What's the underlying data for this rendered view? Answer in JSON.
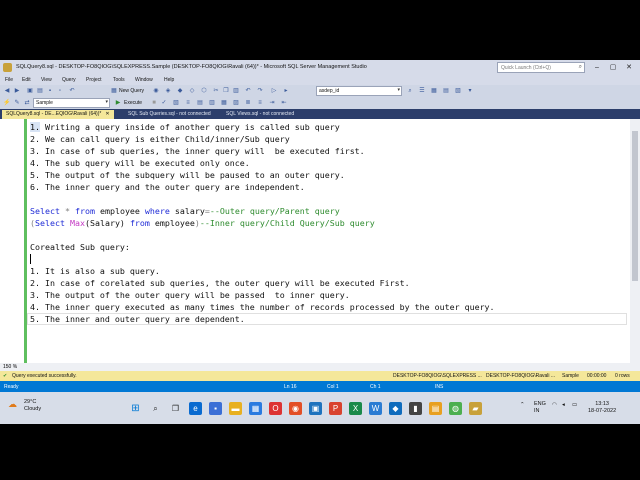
{
  "window": {
    "title": "SQLQuery8.sql - DESKTOP-FO8QIOG\\SQLEXPRESS.Sample (DESKTOP-FO8QIOG\\Ravali (64))* - Microsoft SQL Server Management Studio",
    "quick_launch_placeholder": "Quick Launch (Ctrl+Q)"
  },
  "menu": [
    "File",
    "Edit",
    "View",
    "Query",
    "Project",
    "Tools",
    "Window",
    "Help"
  ],
  "toolbar": {
    "new_query": "New Query",
    "execute": "Execute",
    "database": "Sample",
    "combo_right": "asdep_id"
  },
  "tabs": [
    {
      "label": "SQLQuery8.sql - DE...EQIOG\\Ravali (64))*",
      "active": true
    },
    {
      "label": "SQL Sub Queries.sql - not connected",
      "active": false
    },
    {
      "label": "SQL Views.sql - not connected",
      "active": false
    }
  ],
  "editor": {
    "lines": {
      "l1": {
        "num": "1.",
        "text": " Writing a query inside of another query is called sub query"
      },
      "l2": {
        "num": "2.",
        "text": " We can call query is either Child/inner/Sub query"
      },
      "l3a": "3. In case of sub queries, the inner query will  be executed first.",
      "l4": "4. The sub query will be executed only once.",
      "l5a": "5. The output of the subquery will be paused to an outer query.",
      "l6": "6. The inner query and the outer query are independent.",
      "select_line": {
        "select": "Select",
        "star": " * ",
        "from": "from",
        "employee": " employee ",
        "where": "where",
        "salary": " salary",
        "eq": "=",
        "comment": "--Outer query/Parent query"
      },
      "sub_line": {
        "open": "(",
        "select": "Select",
        "max": " Max",
        "salary": "(Salary) ",
        "from": "from",
        "employee": " employee",
        "close": ")",
        "comment": "--Inner query/Child Query/Sub query"
      },
      "corealted": "Corealted Sub query:",
      "c1": "1. It is also a sub query.",
      "c2": "2. In case of corelated sub queries, the outer query will be executed First.",
      "c3": "3. The output of the outer query will be passed  to inner query.",
      "c4": "4. The inner query executed as many times the number of records processed by the outer query.",
      "c5": "5. The inner and outer query are dependent."
    },
    "zoom": "150 %"
  },
  "query_status": {
    "message": "Query executed successfully.",
    "server": "DESKTOP-FO8QIOG\\SQLEXPRESS ...",
    "user": "DESKTOP-FO8QIOG\\Ravali ...",
    "db": "Sample",
    "time": "00:00:00",
    "rows": "0 rows"
  },
  "app_status": {
    "ready": "Ready",
    "ln": "Ln 16",
    "col": "Col 1",
    "ch": "Ch 1",
    "ins": "INS"
  },
  "taskbar": {
    "temp": "29°C",
    "weather": "Cloudy",
    "lang": "ENG",
    "region": "IN",
    "time": "13:13",
    "date": "18-07-2022"
  },
  "colors": {
    "keyword": "#1f2bd6",
    "comment": "#2e8b2e",
    "function": "#c43bc4",
    "operator": "#808080",
    "tab_active": "#f4e79a",
    "status_blue": "#0078d4"
  }
}
